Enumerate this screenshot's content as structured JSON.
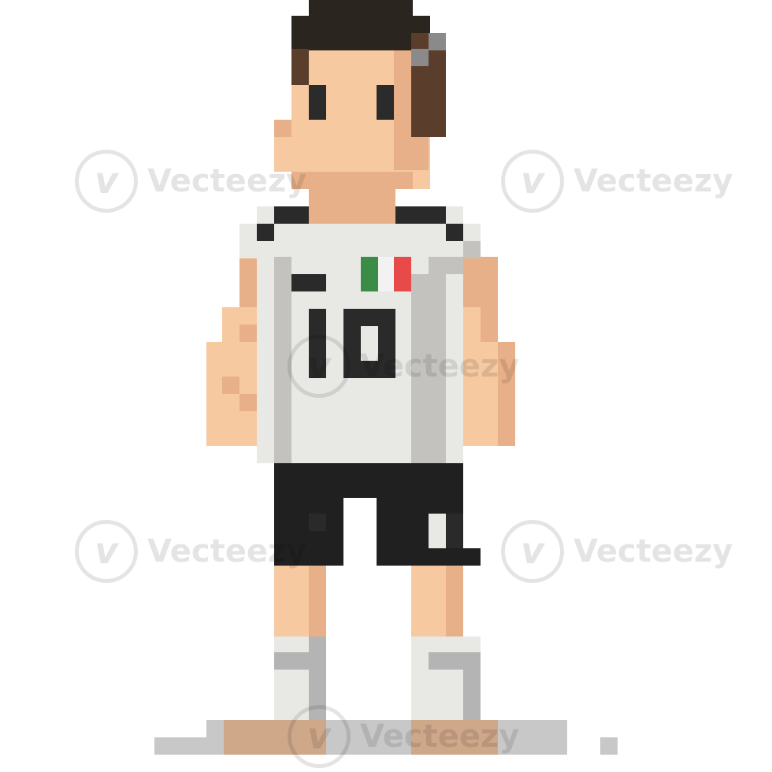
{
  "image": {
    "subject": "pixel-art-soccer-player",
    "jersey_number": "10",
    "watermark_text": "Vecteezy",
    "watermark_logo_letter": "v",
    "colors": {
      "hair": "#5a3d2b",
      "hair_dark": "#2b2520",
      "hair_highlight": "#8a8a8a",
      "skin": "#f7c9a0",
      "skin_shade": "#e8b088",
      "eye": "#2b2b2b",
      "jersey": "#e8e8e4",
      "jersey_shade": "#c4c2be",
      "trim": "#2a2a2a",
      "flag_green": "#3a8c46",
      "flag_white": "#f2f2f2",
      "flag_red": "#e84a4a",
      "shorts": "#202020",
      "shorts_light": "#e8e8e4",
      "socks": "#e8e8e4",
      "socks_shade": "#b4b4b4",
      "shoes": "#cfa88a",
      "shadow": "#c8c8c8",
      "background": "#ffffff"
    }
  }
}
